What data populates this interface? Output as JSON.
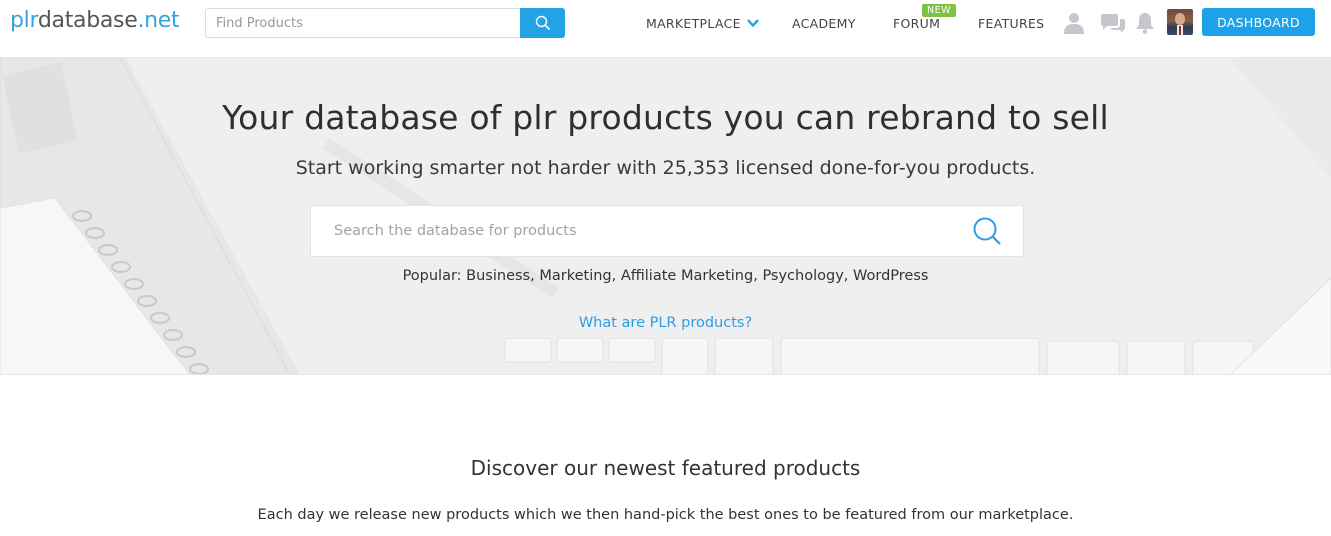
{
  "logo": {
    "prefix": "plr",
    "middle": "database",
    "tld": ".net"
  },
  "header": {
    "search_placeholder": "Find Products",
    "nav": {
      "marketplace": "MARKETPLACE",
      "academy": "ACADEMY",
      "forum": "FORUM",
      "forum_badge": "NEW",
      "features": "FEATURES"
    },
    "dashboard_label": "DASHBOARD"
  },
  "hero": {
    "title": "Your database of plr products you can rebrand to sell",
    "subtitle": "Start working smarter not harder with 25,353 licensed done-for-you products.",
    "search_placeholder": "Search the database for products",
    "popular_label": "Popular:",
    "popular": [
      "Business",
      "Marketing",
      "Affiliate Marketing",
      "Psychology",
      "WordPress"
    ],
    "what_link": "What are PLR products?"
  },
  "featured": {
    "title": "Discover our newest featured products",
    "description": "Each day we release new products which we then hand-pick the best ones to be featured from our marketplace."
  },
  "colors": {
    "accent": "#1da1e8",
    "badge": "#7dc242",
    "link": "#2b9fe3"
  }
}
